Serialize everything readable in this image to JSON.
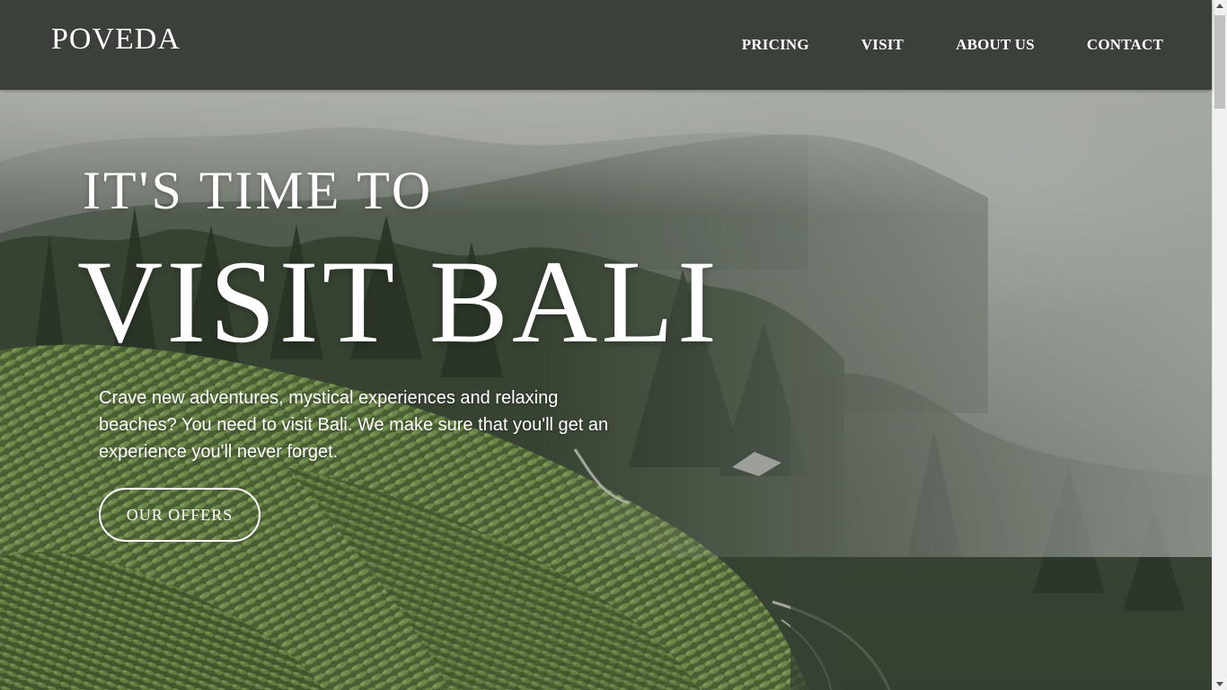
{
  "brand": {
    "logo": "POVEDA"
  },
  "nav": {
    "items": [
      {
        "label": "PRICING"
      },
      {
        "label": "VISIT"
      },
      {
        "label": "ABOUT US"
      },
      {
        "label": "CONTACT"
      }
    ]
  },
  "hero": {
    "headline_small": "IT'S TIME TO",
    "headline_big": "VISIT BALI",
    "lead": "Crave new adventures, mystical experiences and relaxing beaches? You need to visit Bali. We make sure that you'll get an experience you'll never forget.",
    "cta_label": "OUR OFFERS",
    "background_icon": "misty-tea-plantation-image"
  },
  "colors": {
    "header_bg": "#3c403b",
    "text": "#ffffff",
    "scrollbar_track": "#f1f1f1",
    "scrollbar_thumb": "#c1c1c1"
  }
}
